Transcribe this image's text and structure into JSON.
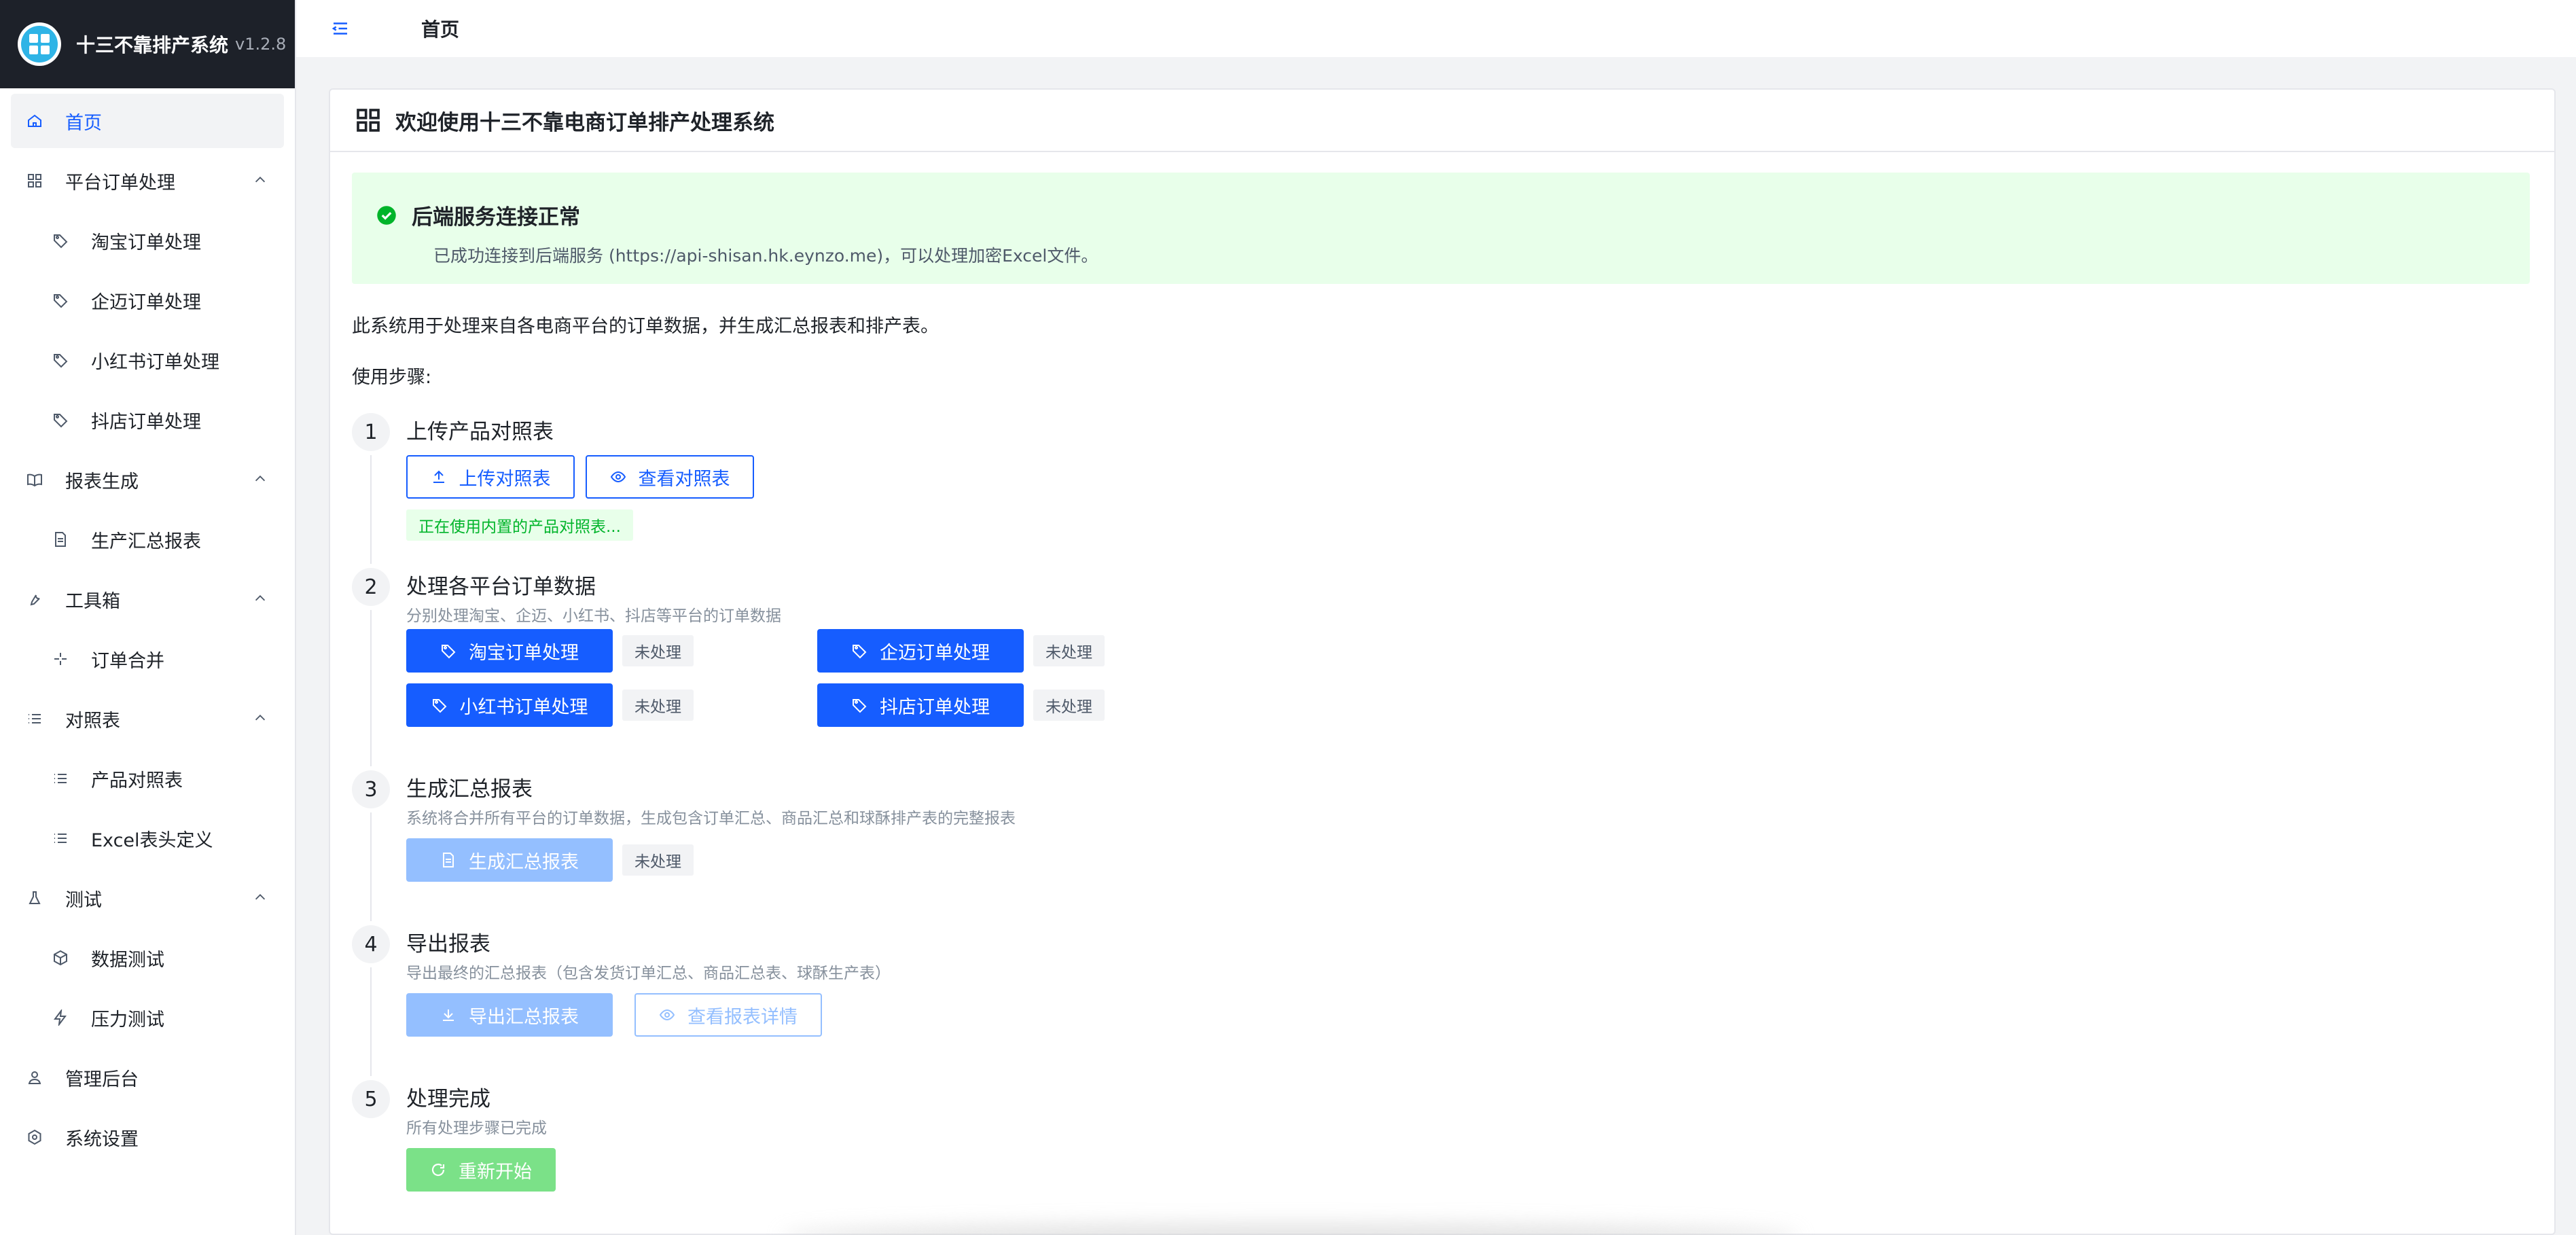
{
  "brand": {
    "title": "十三不靠排产系统",
    "version": "v1.2.8"
  },
  "sidebar": {
    "items": [
      {
        "label": "首页",
        "icon": "home-icon"
      },
      {
        "label": "平台订单处理",
        "icon": "grid-icon"
      },
      {
        "label": "淘宝订单处理",
        "icon": "tag-icon"
      },
      {
        "label": "企迈订单处理",
        "icon": "tag-icon"
      },
      {
        "label": "小红书订单处理",
        "icon": "tag-icon"
      },
      {
        "label": "抖店订单处理",
        "icon": "tag-icon"
      },
      {
        "label": "报表生成",
        "icon": "book-icon"
      },
      {
        "label": "生产汇总报表",
        "icon": "file-icon"
      },
      {
        "label": "工具箱",
        "icon": "tool-icon"
      },
      {
        "label": "订单合并",
        "icon": "merge-icon"
      },
      {
        "label": "对照表",
        "icon": "list-icon"
      },
      {
        "label": "产品对照表",
        "icon": "list-icon"
      },
      {
        "label": "Excel表头定义",
        "icon": "list-icon"
      },
      {
        "label": "测试",
        "icon": "flask-icon"
      },
      {
        "label": "数据测试",
        "icon": "cube-icon"
      },
      {
        "label": "压力测试",
        "icon": "bolt-icon"
      },
      {
        "label": "管理后台",
        "icon": "user-icon"
      },
      {
        "label": "系统设置",
        "icon": "settings-icon"
      }
    ]
  },
  "header": {
    "title": "首页"
  },
  "card": {
    "title": "欢迎使用十三不靠电商订单排产处理系统"
  },
  "alert": {
    "title": "后端服务连接正常",
    "desc": "已成功连接到后端服务 (https://api-shisan.hk.eynzo.me)，可以处理加密Excel文件。"
  },
  "intro": "此系统用于处理来自各电商平台的订单数据，并生成汇总报表和排产表。",
  "steps_label": "使用步骤:",
  "steps": {
    "s1": {
      "num": "1",
      "title": "上传产品对照表",
      "upload_label": "上传对照表",
      "view_label": "查看对照表",
      "status": "正在使用内置的产品对照表..."
    },
    "s2": {
      "num": "2",
      "title": "处理各平台订单数据",
      "desc": "分别处理淘宝、企迈、小红书、抖店等平台的订单数据",
      "taobao": "淘宝订单处理",
      "qimai": "企迈订单处理",
      "xhs": "小红书订单处理",
      "douyin": "抖店订单处理",
      "status": "未处理"
    },
    "s3": {
      "num": "3",
      "title": "生成汇总报表",
      "desc": "系统将合并所有平台的订单数据，生成包含订单汇总、商品汇总和球酥排产表的完整报表",
      "btn": "生成汇总报表",
      "status": "未处理"
    },
    "s4": {
      "num": "4",
      "title": "导出报表",
      "desc": "导出最终的汇总报表（包含发货订单汇总、商品汇总表、球酥生产表）",
      "export_btn": "导出汇总报表",
      "view_btn": "查看报表详情"
    },
    "s5": {
      "num": "5",
      "title": "处理完成",
      "desc": "所有处理步骤已完成",
      "btn": "重新开始"
    }
  },
  "colors": {
    "primary": "#165dff",
    "success": "#00b42a",
    "sidebar_header": "#1d2129"
  }
}
